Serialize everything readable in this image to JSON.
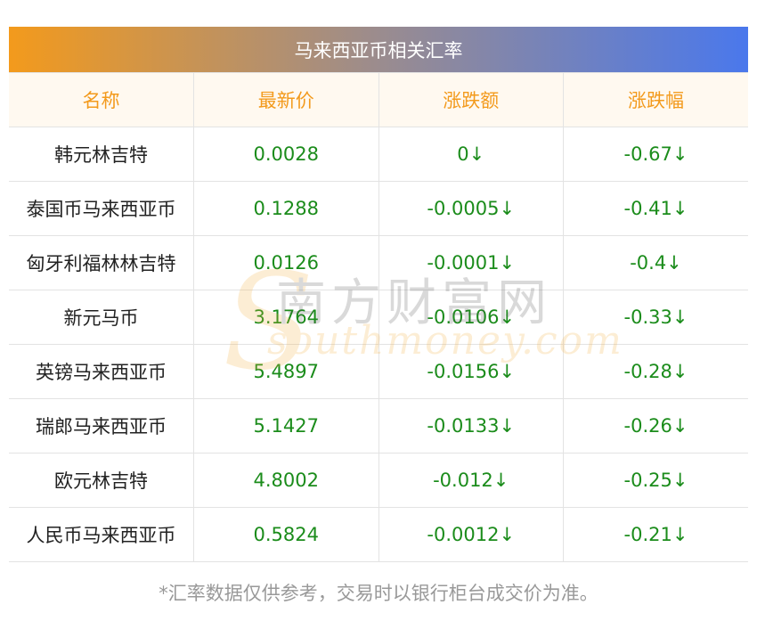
{
  "title": "马来西亚币相关汇率",
  "headers": [
    "名称",
    "最新价",
    "涨跌额",
    "涨跌幅"
  ],
  "rows": [
    {
      "name": "韩元林吉特",
      "price": "0.0028",
      "change": "0↓",
      "pct": "-0.67↓"
    },
    {
      "name": "泰国币马来西亚币",
      "price": "0.1288",
      "change": "-0.0005↓",
      "pct": "-0.41↓"
    },
    {
      "name": "匈牙利福林林吉特",
      "price": "0.0126",
      "change": "-0.0001↓",
      "pct": "-0.4↓"
    },
    {
      "name": "新元马币",
      "price": "3.1764",
      "change": "-0.0106↓",
      "pct": "-0.33↓"
    },
    {
      "name": "英镑马来西亚币",
      "price": "5.4897",
      "change": "-0.0156↓",
      "pct": "-0.28↓"
    },
    {
      "name": "瑞郎马来西亚币",
      "price": "5.1427",
      "change": "-0.0133↓",
      "pct": "-0.26↓"
    },
    {
      "name": "欧元林吉特",
      "price": "4.8002",
      "change": "-0.012↓",
      "pct": "-0.25↓"
    },
    {
      "name": "人民币马来西亚币",
      "price": "0.5824",
      "change": "-0.0012↓",
      "pct": "-0.21↓"
    }
  ],
  "watermark": {
    "cn": "南方财富网",
    "en": "southmoney.com",
    "letter": "S"
  },
  "footnote": "*汇率数据仅供参考，交易时以银行柜台成交价为准。",
  "colors": {
    "header_text": "#f39a1c",
    "value_green": "#1b8c1b",
    "gradient_start": "#f39a1c",
    "gradient_end": "#4a78ec"
  }
}
